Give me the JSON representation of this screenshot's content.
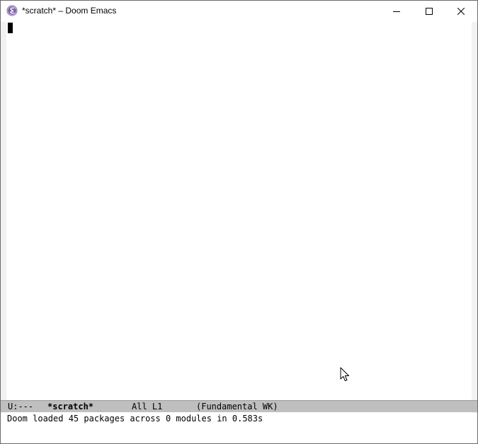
{
  "window": {
    "title": "*scratch* – Doom Emacs",
    "app_icon": "emacs-icon",
    "controls": {
      "minimize": "minimize-icon",
      "maximize": "maximize-icon",
      "close": "close-icon"
    }
  },
  "buffer": {
    "content": ""
  },
  "mode_line": {
    "status": "U:---",
    "buffer_name": "*scratch*",
    "position": "All L1",
    "mode": "(Fundamental WK)"
  },
  "echo_area": {
    "message": "Doom loaded 45 packages across 0 modules in 0.583s"
  },
  "colors": {
    "emacs_icon_purple": "#7b5ea7",
    "mode_line_bg": "#bfbfbf",
    "fringe": "#f2f2f2"
  }
}
